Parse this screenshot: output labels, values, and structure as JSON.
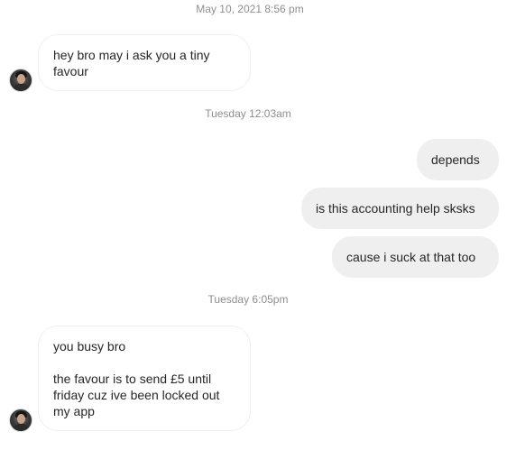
{
  "conversation": {
    "timestamps": [
      "May 10, 2021 8:56 pm",
      "Tuesday 12:03am",
      "Tuesday 6:05pm"
    ],
    "messages": [
      {
        "direction": "incoming",
        "lines": [
          "hey bro may i ask you a tiny",
          "favour"
        ]
      },
      {
        "direction": "outgoing",
        "lines": [
          "depends"
        ]
      },
      {
        "direction": "outgoing",
        "lines": [
          "is this accounting help sksks"
        ]
      },
      {
        "direction": "outgoing",
        "lines": [
          "cause i suck at that too"
        ]
      },
      {
        "direction": "incoming",
        "lines": [
          "you busy bro",
          "",
          "the favour is to send £5 until",
          "friday cuz ive been locked out",
          "my app"
        ]
      }
    ]
  },
  "colors": {
    "timestamp": "#8e8e8e",
    "outgoing_bubble": "#efefef",
    "incoming_border": "#efefef",
    "text": "#262626"
  }
}
